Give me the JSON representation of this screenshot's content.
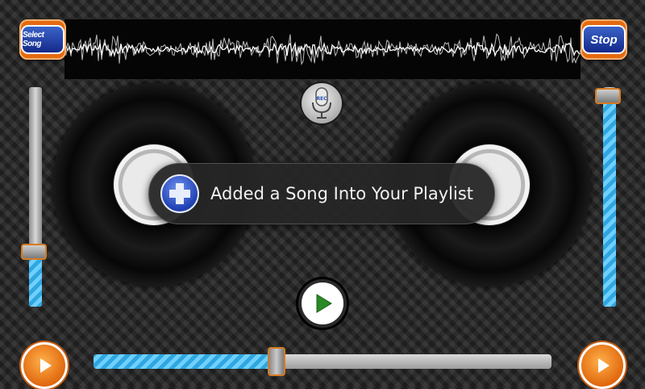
{
  "header": {
    "select_song_label": "Select Song",
    "stop_label": "Stop"
  },
  "mic": {
    "label": "REC",
    "icon": "microphone-icon"
  },
  "toast": {
    "message": "Added a Song Into Your Playlist",
    "icon": "plus-shield-icon"
  },
  "sliders": {
    "left_volume_level": 0.25,
    "right_volume_level": 0.96,
    "crossfader_level": 0.4
  },
  "colors": {
    "accent_orange": "#e56a10",
    "slider_blue": "#2fa6e0",
    "button_blue": "#13298a",
    "play_green": "#2a8a24"
  }
}
